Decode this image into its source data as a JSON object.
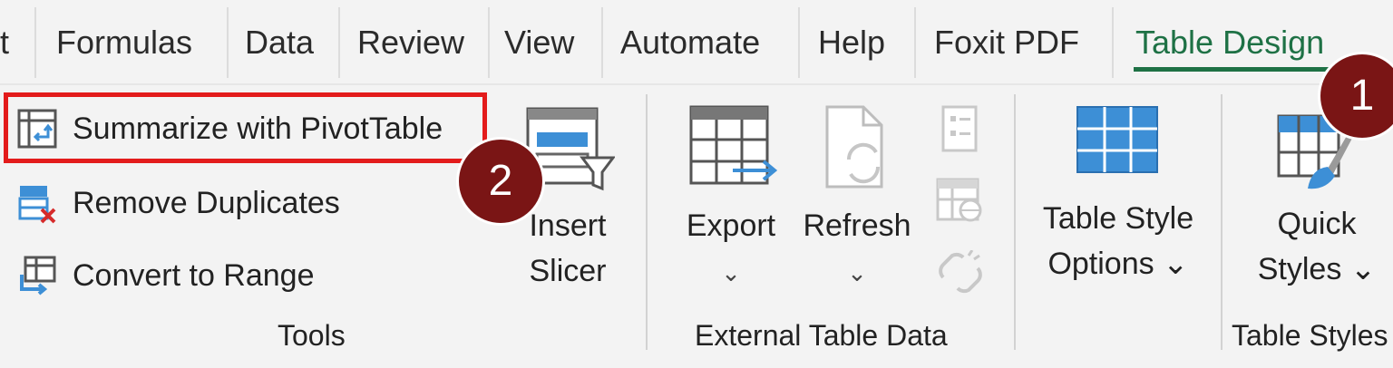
{
  "tabs": {
    "t0": "t",
    "t1": "Formulas",
    "t2": "Data",
    "t3": "Review",
    "t4": "View",
    "t5": "Automate",
    "t6": "Help",
    "t7": "Foxit PDF",
    "t8": "Table Design"
  },
  "tools": {
    "summarize": "Summarize with PivotTable",
    "remove_duplicates": "Remove Duplicates",
    "convert": "Convert to Range",
    "insert_slicer_line1": "Insert",
    "insert_slicer_line2": "Slicer",
    "group_label": "Tools"
  },
  "external": {
    "export": "Export",
    "refresh": "Refresh",
    "chevron": "⌄",
    "group_label": "External Table Data"
  },
  "style_options": {
    "line1": "Table Style",
    "line2": "Options ⌄"
  },
  "table_styles": {
    "line1": "Quick",
    "line2": "Styles ⌄",
    "group_label": "Table Styles"
  },
  "badges": {
    "one": "1",
    "two": "2"
  },
  "colors": {
    "accent_green": "#1e7145",
    "highlight_red": "#e31b1b",
    "badge_maroon": "#7a1515",
    "icon_blue": "#3d8fd6"
  }
}
